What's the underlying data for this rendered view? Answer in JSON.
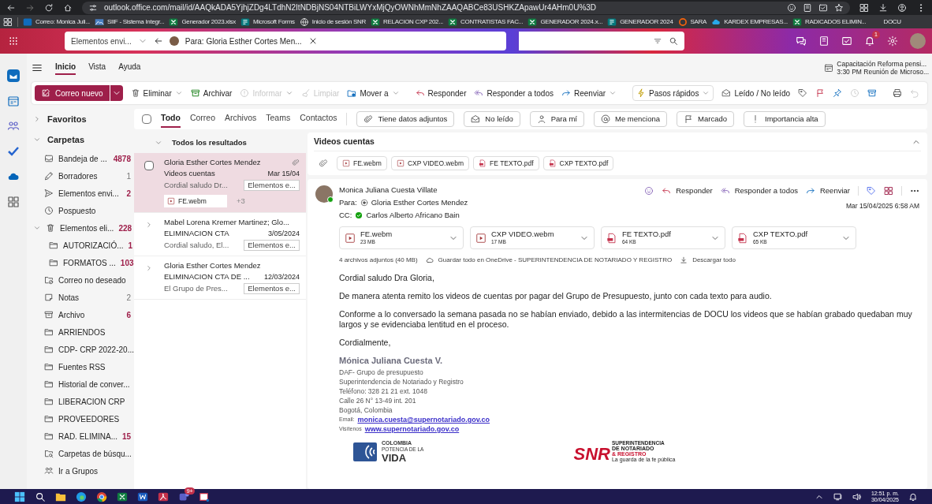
{
  "browser": {
    "url": "outlook.office.com/mail/id/AAQkADA5YjhjZDg4LTdhN2ItNDBjNS04NTBiLWYxMjQyOWNhMmNhZAAQABCe83USHKZApawUr4AHm0U%3D",
    "bookmarks": [
      {
        "label": "Correo: Monica Juli...",
        "kind": "outlook"
      },
      {
        "label": "SIIF - Sistema Integr...",
        "kind": "image"
      },
      {
        "label": "Generador 2023.xlsx",
        "kind": "excel"
      },
      {
        "label": "Microsoft Forms",
        "kind": "forms"
      },
      {
        "label": "Inicio de sesión SNR",
        "kind": "globe"
      },
      {
        "label": "RELACION CXP 202...",
        "kind": "excel"
      },
      {
        "label": "CONTRATISTAS FAC...",
        "kind": "excel"
      },
      {
        "label": "GENERADOR 2024.x...",
        "kind": "excel"
      },
      {
        "label": "GENERADOR 2024",
        "kind": "forms"
      },
      {
        "label": "SARA",
        "kind": "ring"
      },
      {
        "label": "KARDEX EMPRESAS...",
        "kind": "cloud"
      },
      {
        "label": "RADICADOS ELIMIN...",
        "kind": "excel"
      },
      {
        "label": "DOCU",
        "kind": "blank"
      }
    ]
  },
  "header": {
    "folder_dropdown": "Elementos envi...",
    "compose_tab": "Para: Gloria Esther Cortes Men...",
    "notification_badge": "1"
  },
  "ribbon": {
    "tabs": [
      {
        "label": "Inicio",
        "selected": true
      },
      {
        "label": "Vista",
        "selected": false
      },
      {
        "label": "Ayuda",
        "selected": false
      }
    ],
    "reminder": {
      "title": "Capacitación Reforma pensi...",
      "subtitle": "3:30 PM Reunión de Microso..."
    },
    "toolbar": [
      {
        "label": "Correo nuevo",
        "kind": "compose",
        "disabled": false,
        "dropdown": true
      },
      {
        "label": "Eliminar",
        "kind": "trash",
        "disabled": false,
        "dropdown": true
      },
      {
        "label": "Archivar",
        "kind": "archive",
        "disabled": false,
        "dropdown": false
      },
      {
        "label": "Informar",
        "kind": "report",
        "disabled": true,
        "dropdown": true
      },
      {
        "label": "Limpiar",
        "kind": "sweep",
        "disabled": true,
        "dropdown": false
      },
      {
        "label": "Mover a",
        "kind": "move",
        "disabled": false,
        "dropdown": true
      },
      {
        "label": "Responder",
        "kind": "reply",
        "disabled": false,
        "dropdown": false
      },
      {
        "label": "Responder a todos",
        "kind": "reply-all",
        "disabled": false,
        "dropdown": false
      },
      {
        "label": "Reenviar",
        "kind": "forward",
        "disabled": false,
        "dropdown": true
      },
      {
        "label": "Pasos rápidos",
        "kind": "lightning",
        "disabled": false,
        "dropdown": true
      },
      {
        "label": "Leído / No leído",
        "kind": "envelope",
        "disabled": false,
        "dropdown": false
      }
    ]
  },
  "sections": [
    {
      "label": "Favoritos",
      "expanded": false
    },
    {
      "label": "Carpetas",
      "expanded": true,
      "folders": [
        {
          "name": "Bandeja de ...",
          "kind": "inbox",
          "count": "4878",
          "unread": true
        },
        {
          "name": "Borradores",
          "kind": "drafts",
          "count": "1",
          "unread": false
        },
        {
          "name": "Elementos envi...",
          "kind": "sent",
          "count": "2",
          "unread": true
        },
        {
          "name": "Pospuesto",
          "kind": "snoozed"
        },
        {
          "name": "Elementos eli...",
          "kind": "deleted",
          "count": "228",
          "unread": true,
          "expanded": true,
          "children": [
            {
              "name": "AUTORIZACIÓ...",
              "kind": "folder",
              "count": "1",
              "unread": true
            },
            {
              "name": "FORMATOS ...",
              "kind": "folder",
              "count": "103",
              "unread": true
            }
          ]
        },
        {
          "name": "Correo no deseado",
          "kind": "junk"
        },
        {
          "name": "Notas",
          "kind": "notes",
          "count": "2",
          "unread": false
        },
        {
          "name": "Archivo",
          "kind": "archive",
          "count": "6",
          "unread": true
        },
        {
          "name": "ARRIENDOS",
          "kind": "folder"
        },
        {
          "name": "CDP- CRP 2022-20...",
          "kind": "folder"
        },
        {
          "name": "Fuentes RSS",
          "kind": "folder"
        },
        {
          "name": "Historial de conver...",
          "kind": "folder"
        },
        {
          "name": "LIBERACION CRP",
          "kind": "folder"
        },
        {
          "name": "PROVEEDORES",
          "kind": "folder"
        },
        {
          "name": "RAD. ELIMINA...",
          "kind": "folder",
          "count": "15",
          "unread": true
        },
        {
          "name": "Carpetas de búsqu...",
          "kind": "search"
        },
        {
          "name": "Ir a Grupos",
          "kind": "groups"
        }
      ]
    }
  ],
  "filters": {
    "select_all": {
      "checked": false
    },
    "tabs": [
      {
        "label": "Todo",
        "selected": true
      },
      {
        "label": "Correo",
        "selected": false
      },
      {
        "label": "Archivos",
        "selected": false
      },
      {
        "label": "Teams",
        "selected": false
      },
      {
        "label": "Contactos",
        "selected": false
      }
    ],
    "chips": [
      {
        "label": "Tiene datos adjuntos",
        "kind": "paperclip"
      },
      {
        "label": "No leído",
        "kind": "envelope"
      },
      {
        "label": "Para mí",
        "kind": "person"
      },
      {
        "label": "Me menciona",
        "kind": "at"
      },
      {
        "label": "Marcado",
        "kind": "flag"
      },
      {
        "label": "Importancia alta",
        "kind": "important"
      }
    ]
  },
  "message_list": {
    "header": "Todos los resultados",
    "messages": [
      {
        "kind": "message",
        "checked": false,
        "selected": true,
        "sender": "Gloria Esther Cortes Mendez",
        "subject": "Videos cuentas",
        "date": "Mar 15/04",
        "preview": "Cordial saludo Dr...",
        "folder": "Elementos e...",
        "has_attachment": true,
        "attachment": "FE.webm",
        "more": "+3"
      },
      {
        "kind": "thread",
        "selected": false,
        "sender": "Mabel Lorena Kremer Martinez; Glo...",
        "subject": "ELIMINACION CTA",
        "date": "3/05/2024",
        "preview": "Cordial saludo, El...",
        "folder": "Elementos e..."
      },
      {
        "kind": "thread",
        "selected": false,
        "sender": "Gloria Esther Cortes Mendez",
        "subject": "ELIMINACION CTA DE ...",
        "date": "12/03/2024",
        "preview": "El Grupo de Pres...",
        "folder": "Elementos e..."
      }
    ]
  },
  "reading_pane": {
    "subject": "Videos cuentas",
    "attachment_chips": [
      {
        "name": "FE.webm",
        "kind": "video"
      },
      {
        "name": "CXP VIDEO.webm",
        "kind": "video"
      },
      {
        "name": "FE TEXTO.pdf",
        "kind": "pdf"
      },
      {
        "name": "CXP TEXTO.pdf",
        "kind": "pdf"
      }
    ],
    "message": {
      "from": "Monica Juliana Cuesta Villate",
      "to_label": "Para:",
      "to": "Gloria Esther Cortes Mendez",
      "cc_label": "CC:",
      "cc": "Carlos Alberto Africano Bain",
      "date": "Mar 15/04/2025 6:58 AM",
      "actions": [
        {
          "label": "Responder",
          "kind": "reply"
        },
        {
          "label": "Responder a todos",
          "kind": "reply-all"
        },
        {
          "label": "Reenviar",
          "kind": "forward"
        }
      ],
      "attachments": [
        {
          "name": "FE.webm",
          "size": "23 MB",
          "kind": "video"
        },
        {
          "name": "CXP VIDEO.webm",
          "size": "17 MB",
          "kind": "video"
        },
        {
          "name": "FE TEXTO.pdf",
          "size": "64 KB",
          "kind": "pdf"
        },
        {
          "name": "CXP TEXTO.pdf",
          "size": "65 KB",
          "kind": "pdf"
        }
      ],
      "attachment_summary": "4 archivos adjuntos (40 MB)",
      "save_all": "Guardar todo en OneDrive - SUPERINTENDENCIA DE NOTARIADO Y REGISTRO",
      "download_all": "Descargar todo",
      "body": [
        "Cordial saludo Dra Gloria,",
        "De manera atenta remito los videos de cuentas por pagar del Grupo de Presupuesto, junto con cada texto para audio.",
        "Conforme a lo conversado la semana pasada no se habían enviado, debido a las intermitencias de DOCU los videos que se habían grabado quedaban muy largos y se evidenciaba lentitud en el proceso.",
        "Cordialmente,"
      ],
      "signature": {
        "name": "Mónica Juliana Cuesta V.",
        "lines": [
          "DAF- Grupo de presupuesto",
          "Superintendencia de Notariado y Registro",
          "Teléfono: 328 21 21 ext. 1048",
          "Calle 26 N° 13-49 int. 201",
          "Bogotá, Colombia"
        ],
        "links": [
          {
            "label": "Email:",
            "link": "monica.cuesta@supernotariado.gov.co"
          },
          {
            "label": "Visítenos",
            "link": "www.supernotariado.gov.co"
          }
        ]
      },
      "logos": {
        "colombia": [
          "COLOMBIA",
          "POTENCIA DE LA",
          "VIDA"
        ],
        "snr": {
          "mark": "SNR",
          "lines": [
            "SUPERINTENDENCIA",
            "DE NOTARIADO",
            "& REGISTRO"
          ],
          "tagline": "La guarda de la fe pública"
        }
      }
    }
  },
  "taskbar": {
    "teams_badge": "9+",
    "time": "12:51 p. m.",
    "date": "30/04/2025"
  }
}
